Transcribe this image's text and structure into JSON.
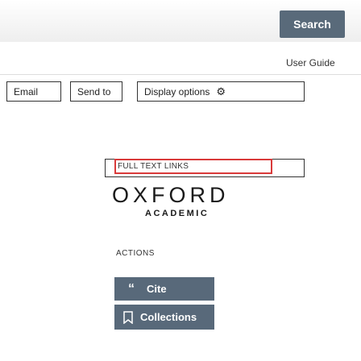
{
  "header": {
    "search_label": "Search",
    "user_guide_label": "User Guide"
  },
  "toolbar": {
    "email_label": "Email",
    "send_to_label": "Send to",
    "display_options_label": "Display options",
    "display_options_icon": "gear-icon"
  },
  "sidebar": {
    "full_text_links_label": "FULL TEXT LINKS",
    "publisher_logo": {
      "name": "OXFORD",
      "subtitle": "ACADEMIC"
    },
    "actions_heading": "ACTIONS",
    "actions": [
      {
        "label": "Cite",
        "icon": "quote-icon"
      },
      {
        "label": "Collections",
        "icon": "bookmark-icon"
      }
    ]
  },
  "colors": {
    "search_button_bg": "#596a7a",
    "action_button_bg": "#58697a",
    "highlight_border": "#d93a3a"
  }
}
